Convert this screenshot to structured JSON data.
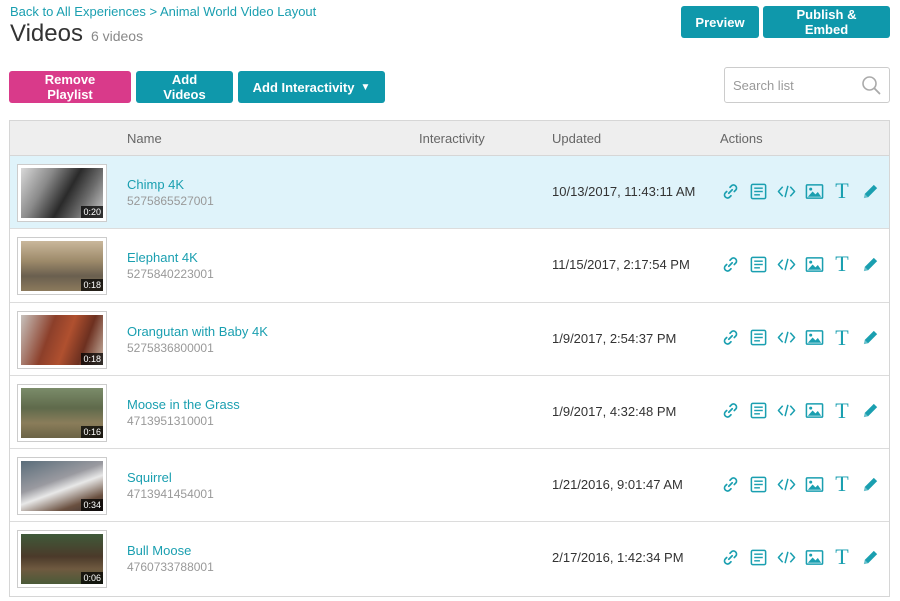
{
  "breadcrumb": "Back to All Experiences > Animal World Video Layout",
  "page_title": "Videos",
  "video_count": "6 videos",
  "buttons": {
    "preview": "Preview",
    "publish": "Publish & Embed",
    "remove_playlist": "Remove Playlist",
    "add_videos": "Add Videos",
    "add_interactivity": "Add Interactivity",
    "interactivity_caret": "▼"
  },
  "search": {
    "placeholder": "Search list"
  },
  "columns": {
    "name": "Name",
    "interactivity": "Interactivity",
    "updated": "Updated",
    "actions": "Actions"
  },
  "colors": {
    "accent": "#0f98ab",
    "danger": "#d93a8a",
    "selected_row": "#dff3fa"
  },
  "action_icons": [
    "link-icon",
    "document-icon",
    "code-icon",
    "image-icon",
    "text-icon",
    "pencil-icon"
  ],
  "rows": [
    {
      "name": "Chimp 4K",
      "id": "5275865527001",
      "updated": "10/13/2017, 11:43:11 AM",
      "duration": "0:20",
      "selected": true
    },
    {
      "name": "Elephant 4K",
      "id": "5275840223001",
      "updated": "11/15/2017, 2:17:54 PM",
      "duration": "0:18",
      "selected": false
    },
    {
      "name": "Orangutan with Baby 4K",
      "id": "5275836800001",
      "updated": "1/9/2017, 2:54:37 PM",
      "duration": "0:18",
      "selected": false
    },
    {
      "name": "Moose in the Grass",
      "id": "4713951310001",
      "updated": "1/9/2017, 4:32:48 PM",
      "duration": "0:16",
      "selected": false
    },
    {
      "name": "Squirrel",
      "id": "4713941454001",
      "updated": "1/21/2016, 9:01:47 AM",
      "duration": "0:34",
      "selected": false
    },
    {
      "name": "Bull Moose",
      "id": "4760733788001",
      "updated": "2/17/2016, 1:42:34 PM",
      "duration": "0:06",
      "selected": false
    }
  ]
}
